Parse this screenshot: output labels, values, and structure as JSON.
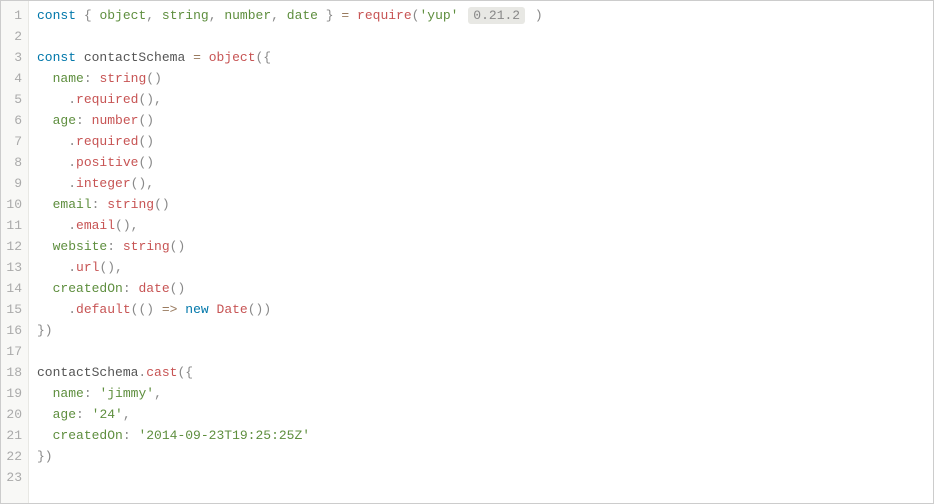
{
  "lineCount": 23,
  "code": {
    "kw_const": "const",
    "kw_new": "new",
    "require": "require",
    "pkg": "'yup'",
    "version": "0.21.2",
    "destruct": {
      "object": "object",
      "string": "string",
      "number": "number",
      "date": "date"
    },
    "schemaVar": "contactSchema",
    "object_fn": "object",
    "fields": {
      "name": "name",
      "age": "age",
      "email": "email",
      "website": "website",
      "createdOn": "createdOn"
    },
    "methods": {
      "string": "string",
      "number": "number",
      "date": "date",
      "required": "required",
      "positive": "positive",
      "integer": "integer",
      "email": "email",
      "url": "url",
      "default": "default",
      "Date": "Date",
      "cast": "cast"
    },
    "cast": {
      "name_key": "name",
      "name_val": "'jimmy'",
      "age_key": "age",
      "age_val": "'24'",
      "createdOn_key": "createdOn",
      "createdOn_val": "'2014-09-23T19:25:25Z'"
    }
  }
}
